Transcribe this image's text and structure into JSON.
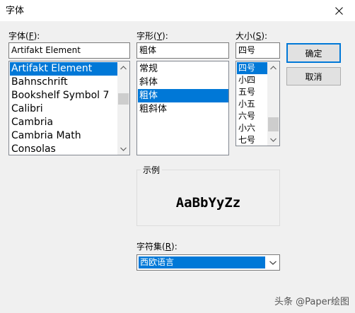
{
  "window": {
    "title": "字体"
  },
  "font": {
    "label": "字体(",
    "accel": "F",
    "label_end": "):",
    "value": "Artifakt Element",
    "items": [
      "Artifakt Element",
      "Bahnschrift",
      "Bookshelf Symbol 7",
      "Calibri",
      "Cambria",
      "Cambria Math",
      "Consolas"
    ],
    "selected_index": 0
  },
  "style": {
    "label": "字形(",
    "accel": "Y",
    "label_end": "):",
    "value": "粗体",
    "items": [
      "常规",
      "斜体",
      "粗体",
      "粗斜体"
    ],
    "selected_index": 2
  },
  "size": {
    "label": "大小(",
    "accel": "S",
    "label_end": "):",
    "value": "四号",
    "items": [
      "四号",
      "小四",
      "五号",
      "小五",
      "六号",
      "小六",
      "七号"
    ],
    "selected_index": 0
  },
  "buttons": {
    "ok": "确定",
    "cancel": "取消"
  },
  "sample": {
    "title": "示例",
    "text": "AaBbYyZz"
  },
  "charset": {
    "label": "字符集(",
    "accel": "R",
    "label_end": "):",
    "value": "西欧语言"
  },
  "watermark": "头条 @Paper绘图",
  "icons": {
    "close": "close-icon",
    "up": "chevron-up-icon",
    "down": "chevron-down-icon"
  }
}
